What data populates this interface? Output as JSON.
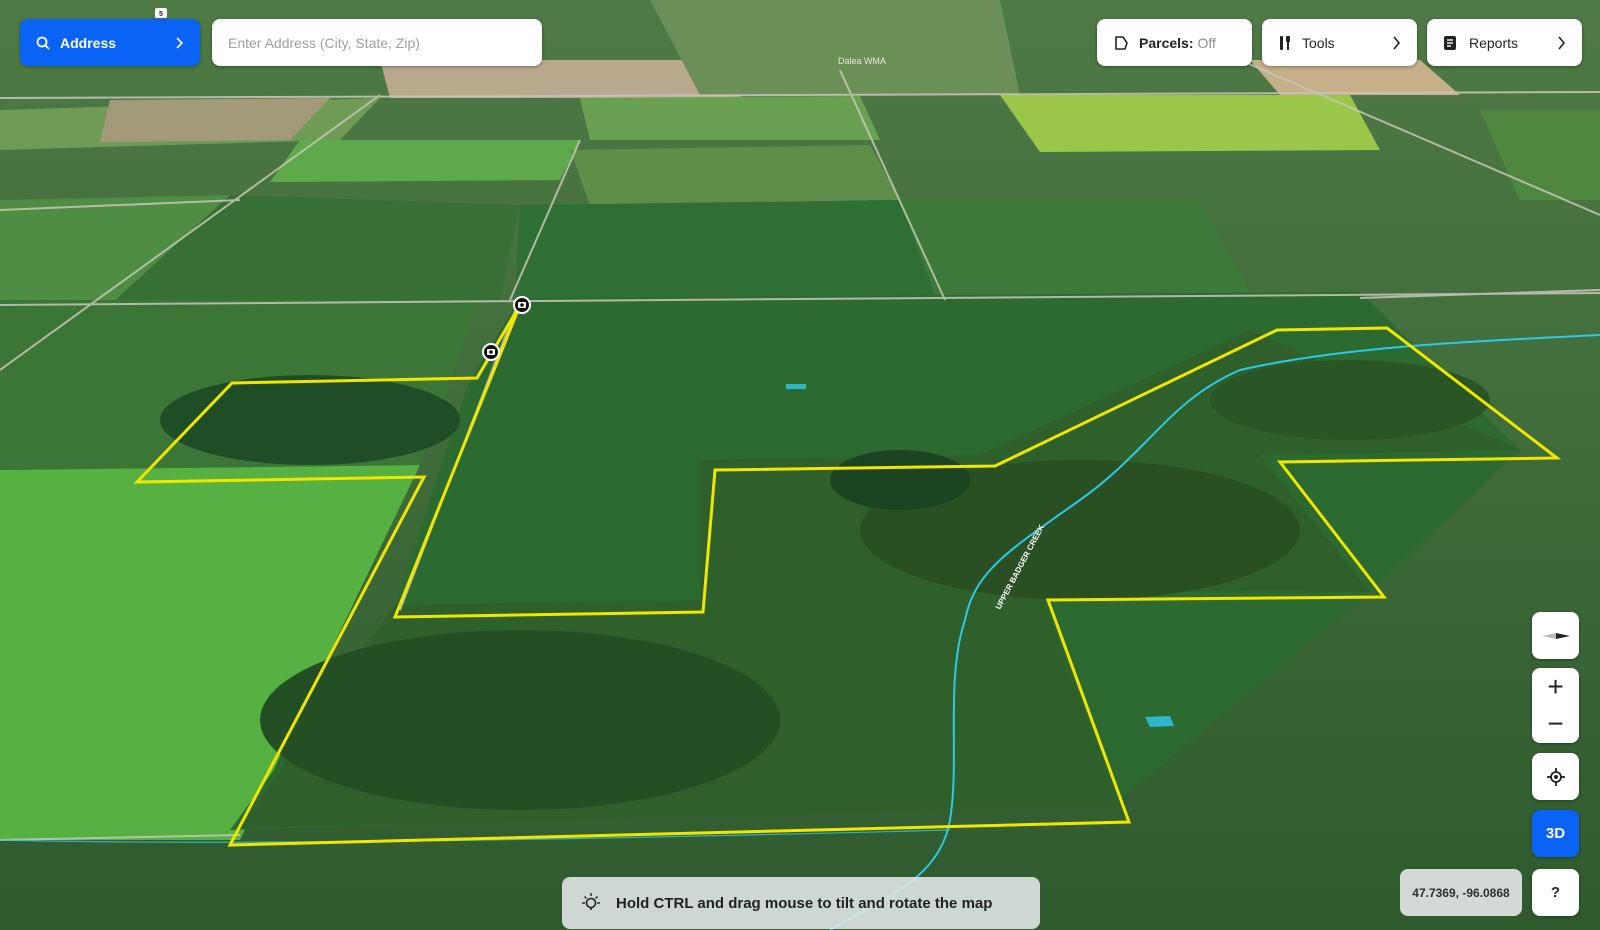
{
  "search": {
    "mode_label": "Address",
    "placeholder": "Enter Address (City, State, Zip)"
  },
  "toolbar": {
    "parcels_label": "Parcels:",
    "parcels_state": "Off",
    "tools_label": "Tools",
    "reports_label": "Reports"
  },
  "map_controls": {
    "zoom_in": "+",
    "zoom_out": "−",
    "three_d_label": "3D",
    "help_label": "?"
  },
  "coordinates": "47.7369, -96.0868",
  "hint": "Hold CTRL and drag mouse to tilt and rotate the map",
  "map": {
    "top_labels": [
      "Dalea WMA"
    ],
    "creek_label": "UPPER BADGER CREEK",
    "highway_shield": "5"
  },
  "colors": {
    "accent": "#0b63f5",
    "parcel_outline": "#f2e600",
    "creek": "#2ec9e6"
  },
  "icons": [
    "search-icon",
    "chevron-right-icon",
    "parcel-icon",
    "tools-icon",
    "reports-icon",
    "compass-icon",
    "locate-icon",
    "lightbulb-icon",
    "camera-icon"
  ]
}
